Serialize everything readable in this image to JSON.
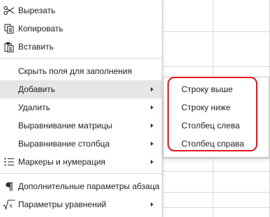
{
  "menu": {
    "cut": {
      "label": "Вырезать",
      "icon": "scissors-icon"
    },
    "copy": {
      "label": "Копировать",
      "icon": "copy-icon"
    },
    "paste": {
      "label": "Вставить",
      "icon": "paste-icon"
    },
    "hide_fields": {
      "label": "Скрыть поля для заполнения"
    },
    "add": {
      "label": "Добавить"
    },
    "delete": {
      "label": "Удалить"
    },
    "matrix_align": {
      "label": "Выравнивание матрицы"
    },
    "column_align": {
      "label": "Выравнивание столбца"
    },
    "bullets": {
      "label": "Маркеры и нумерация",
      "icon": "list-icon"
    },
    "paragraph": {
      "label": "Дополнительные параметры абзаца",
      "icon": "pilcrow-icon"
    },
    "equation": {
      "label": "Параметры уравнений",
      "icon": "equation-icon"
    }
  },
  "submenu": {
    "row_above": "Строку выше",
    "row_below": "Строку ниже",
    "col_left": "Столбец слева",
    "col_right": "Столбец справа"
  },
  "colors": {
    "highlight": "#e8141e",
    "active_item": "#e6e6e6",
    "grid": "#d9d9d9"
  }
}
